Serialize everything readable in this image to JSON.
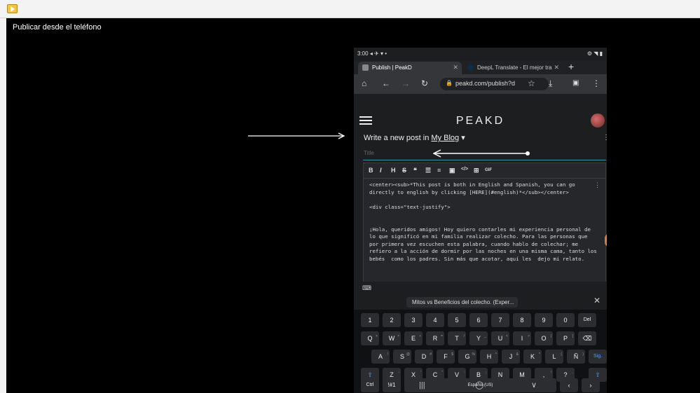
{
  "window": {
    "caption": "Publicar desde el  teléfono"
  },
  "status_bar": {
    "time": "3:00",
    "icons_left": "◂ ✈ ▾ •",
    "icons_right": "⚙ ◥ ▮"
  },
  "browser": {
    "tabs": [
      {
        "label": "Publish | PeakD",
        "close": "✕"
      },
      {
        "label": "DeepL Translate - El mejor tra",
        "close": "✕"
      }
    ],
    "new_tab": "+",
    "url": "peakd.com/publish?d"
  },
  "page": {
    "logo": "PEAKD",
    "write_prefix": "Write a new post in",
    "blog_link": "My Blog",
    "title_placeholder": "Title"
  },
  "editor": {
    "toolbar": [
      "B",
      "I",
      "H",
      "S",
      "❝",
      "☰",
      "≡",
      "▣",
      "</>",
      "⊞",
      "GIF"
    ],
    "text": "<center><sub>*This post is both in English and Spanish, you can go directly to english by clicking [HERE](#english)*</sub></center>\n\n<div class=\"text-justify\">\n\n\n¡Hola, queridos amigos! Hoy quiero contarles mi experiencia personal de lo que significó en mi familia realizar colecho. Para las personas que por primera vez escuchen esta palabra, cuando hablo de colechar; me refiero a la acción de dormir por las noches en una misma cama, tanto los bebés  como los padres. Sin más que acotar, aquí les  dejo mi relato."
  },
  "keyboard": {
    "suggestion": "Mitos vs Beneficios del colecho. (Exper...",
    "suggestion_close": "✕",
    "row1": [
      "1",
      "2",
      "3",
      "4",
      "5",
      "6",
      "7",
      "8",
      "9",
      "0",
      "Del"
    ],
    "row2": [
      "Q",
      "W",
      "E",
      "R",
      "T",
      "Y",
      "U",
      "I",
      "O",
      "P",
      "⌫"
    ],
    "row2_sub": [
      "+",
      "×",
      "÷",
      "=",
      "/",
      "_",
      "<",
      ">",
      "[",
      "]",
      ""
    ],
    "row3": [
      "A",
      "S",
      "D",
      "F",
      "G",
      "H",
      "J",
      "K",
      "L",
      "Ñ",
      "Sig."
    ],
    "row3_sub": [
      "!",
      "@",
      "#",
      "$",
      "%",
      "^",
      "&",
      "*",
      "(",
      ")",
      ""
    ],
    "row4": [
      "⇧",
      "Z",
      "X",
      "C",
      "V",
      "B",
      "N",
      "M",
      ",",
      "?",
      "⇧"
    ],
    "row4_sub": [
      "",
      "-",
      "'",
      "\"",
      ":",
      ";",
      "",
      "",
      "!",
      ".",
      ""
    ],
    "ctrl": "Ctrl",
    "symbols": "!#1",
    "space": "Español (US)",
    "left": "‹",
    "right": "›"
  },
  "navbar": {
    "recents": "|||",
    "home": "◯",
    "back": "∨"
  }
}
